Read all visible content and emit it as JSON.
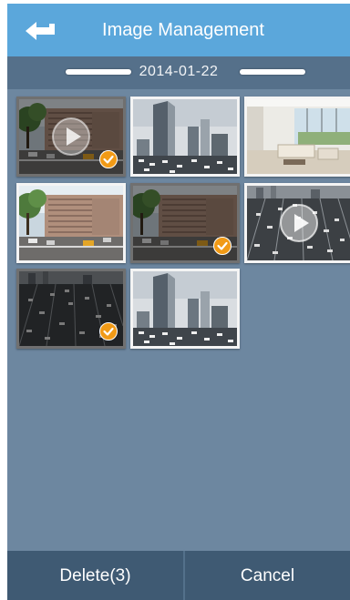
{
  "header": {
    "title": "Image Management",
    "back_icon": "back-arrow-icon"
  },
  "date_bar": {
    "date": "2014-01-22"
  },
  "grid": {
    "items": [
      {
        "kind": "video",
        "scene": "building-street",
        "selected": true
      },
      {
        "kind": "photo",
        "scene": "skyline-bw",
        "selected": false
      },
      {
        "kind": "photo",
        "scene": "interior",
        "selected": false
      },
      {
        "kind": "photo",
        "scene": "building-street",
        "selected": false
      },
      {
        "kind": "photo",
        "scene": "building-street",
        "selected": true
      },
      {
        "kind": "video",
        "scene": "highway-bw",
        "selected": false
      },
      {
        "kind": "photo",
        "scene": "highway-bw",
        "selected": true
      },
      {
        "kind": "photo",
        "scene": "skyline-bw",
        "selected": false
      }
    ]
  },
  "footer": {
    "delete_label": "Delete(3)",
    "cancel_label": "Cancel"
  },
  "colors": {
    "header": "#5ba7db",
    "background": "#6d87a0",
    "footer": "#3f5a73",
    "check": "#f19a16"
  }
}
